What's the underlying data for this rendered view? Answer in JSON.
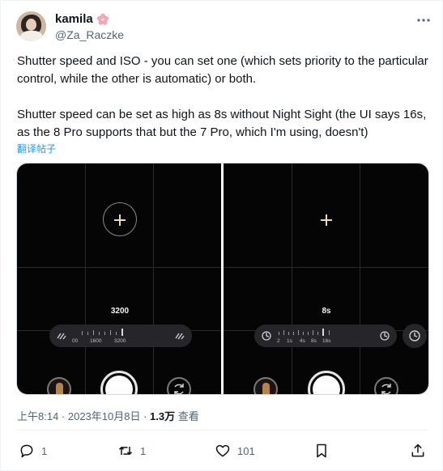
{
  "author": {
    "display_name": "kamila",
    "handle": "@Za_Raczke",
    "name_emoji_icon": "cherry-blossom-icon"
  },
  "tweet": {
    "paragraph_1": "Shutter speed and ISO - you can set one (which sets priority to the particular control, while the other is automatic) or both.",
    "paragraph_2": "Shutter speed can be set as high as 8s without Night Sight (the UI says 16s, as the 8 Pro supports that but the 7 Pro, which I'm using, doesn't)",
    "translate_label": "翻译帖子"
  },
  "media": {
    "left": {
      "value": "3200",
      "ticks": [
        "00",
        "1600",
        "3200"
      ]
    },
    "right": {
      "value": "8s",
      "ticks": [
        "2",
        "1s",
        "4s",
        "8s",
        "16s"
      ]
    }
  },
  "meta": {
    "time_date": "上午8:14 · 2023年10月8日 · ",
    "views_count": "1.3万",
    "views_label": " 查看"
  },
  "actions": {
    "replies": "1",
    "reposts": "1",
    "likes": "101"
  },
  "colors": {
    "text": "#0f1419",
    "muted": "#536471",
    "link": "#1d9bf0"
  }
}
